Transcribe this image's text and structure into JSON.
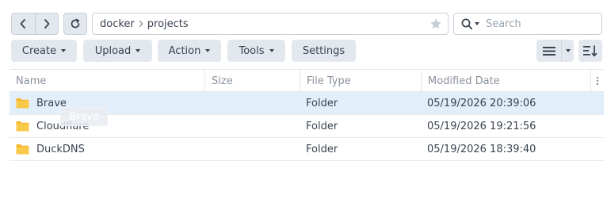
{
  "path": {
    "crumbs": [
      "docker",
      "projects"
    ]
  },
  "search": {
    "placeholder": "Search"
  },
  "toolbar": {
    "create_label": "Create",
    "upload_label": "Upload",
    "action_label": "Action",
    "tools_label": "Tools",
    "settings_label": "Settings"
  },
  "columns": {
    "name": "Name",
    "size": "Size",
    "file_type": "File Type",
    "modified": "Modified Date"
  },
  "rows": [
    {
      "name": "Brave",
      "size": "",
      "type": "Folder",
      "modified": "05/19/2026 20:39:06",
      "selected": true
    },
    {
      "name": "Cloudflare",
      "size": "",
      "type": "Folder",
      "modified": "05/19/2026 19:21:56",
      "selected": false
    },
    {
      "name": "DuckDNS",
      "size": "",
      "type": "Folder",
      "modified": "05/19/2026 18:39:40",
      "selected": false
    }
  ],
  "drag_ghost": {
    "label": "Brave"
  },
  "icons": {
    "back": "chevron-left-icon",
    "forward": "chevron-right-icon",
    "refresh": "refresh-icon",
    "favorite": "star-icon",
    "search": "search-icon",
    "view": "list-view-icon",
    "sort": "sort-icon",
    "column_menu": "more-vertical-icon",
    "folder": "folder-icon"
  },
  "colors": {
    "selected_row": "#e3eefb",
    "button_bg": "#e3e8ef",
    "folder": "#f5b92e"
  }
}
